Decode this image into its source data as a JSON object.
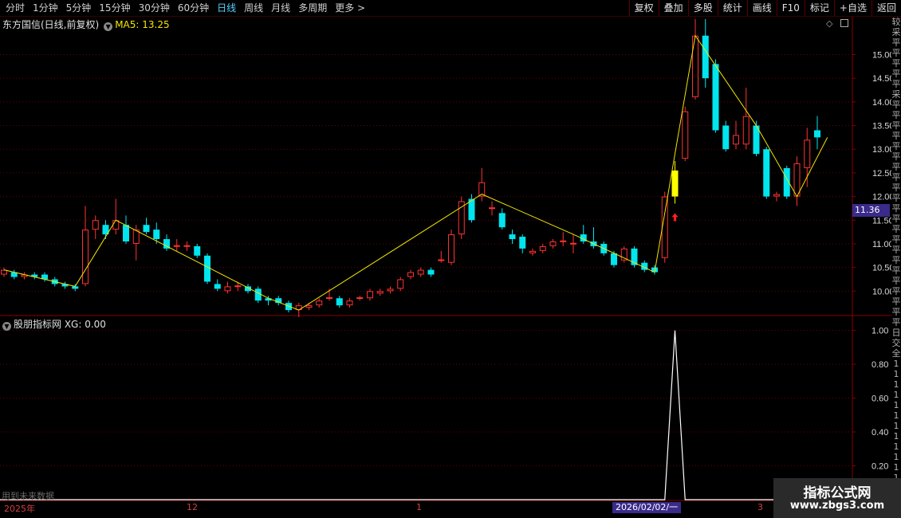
{
  "toolbar": {
    "left_items": [
      "分时",
      "1分钟",
      "5分钟",
      "15分钟",
      "30分钟",
      "60分钟",
      "日线",
      "周线",
      "月线",
      "多周期",
      "更多 >"
    ],
    "selected": "日线",
    "right_buttons": [
      "复权",
      "叠加",
      "多股",
      "统计",
      "画线",
      "F10",
      "标记",
      "+自选",
      "返回"
    ]
  },
  "main_panel": {
    "stock_name": "东方国信(日线,前复权)",
    "ma_label": "MA5: 13.25",
    "current_price_tag": "11.36",
    "price_axis_labels": [
      "15.00",
      "14.50",
      "14.00",
      "13.50",
      "13.00",
      "12.50",
      "12.00",
      "11.50",
      "11.00",
      "10.50",
      "10.00"
    ],
    "colors": {
      "up": "#ff3232",
      "down": "#00e5ee",
      "ma5": "#f2e600",
      "highlight": "#ffff00",
      "grid": "#6a0000",
      "background": "#000000"
    }
  },
  "sub_panel": {
    "title": "股朋指标网 XG: 0.00",
    "axis_labels": [
      "1.00",
      "0.80",
      "0.60",
      "0.40",
      "0.20"
    ],
    "future_note": "用到未来数据"
  },
  "x_axis": {
    "labels": [
      "2025年",
      "12",
      "1",
      "3"
    ],
    "cursor_date": "2026/02/02/一"
  },
  "right_strip_chars": [
    "较",
    "采",
    "平",
    "平",
    "平",
    "平",
    "平",
    "采",
    "平",
    "平",
    "平",
    "平",
    "平",
    "平",
    "平",
    "平",
    "平",
    "平",
    "平",
    "平",
    "平",
    "平",
    "平",
    "平",
    "平",
    "平",
    "平",
    "平",
    "平",
    "平",
    "日",
    "交",
    "全",
    "1",
    "1",
    "1",
    "1",
    "1",
    "1",
    "1",
    "1",
    "1",
    "1",
    "1",
    "1",
    "1",
    "1",
    "1",
    "1"
  ],
  "watermark": {
    "line1": "指标公式网",
    "line2": "www.zbgs3.com"
  },
  "chart_data": {
    "type": "candlestick",
    "y_range": [
      9.5,
      15.8
    ],
    "candles": [
      {
        "o": 10.35,
        "c": 10.45,
        "h": 10.5,
        "l": 10.3
      },
      {
        "o": 10.4,
        "c": 10.3,
        "h": 10.45,
        "l": 10.25
      },
      {
        "o": 10.3,
        "c": 10.35,
        "h": 10.4,
        "l": 10.25
      },
      {
        "o": 10.35,
        "c": 10.3,
        "h": 10.4,
        "l": 10.25
      },
      {
        "o": 10.35,
        "c": 10.25,
        "h": 10.4,
        "l": 10.2
      },
      {
        "o": 10.25,
        "c": 10.15,
        "h": 10.3,
        "l": 10.1
      },
      {
        "o": 10.15,
        "c": 10.1,
        "h": 10.2,
        "l": 10.05
      },
      {
        "o": 10.1,
        "c": 10.05,
        "h": 10.15,
        "l": 10.0
      },
      {
        "o": 10.15,
        "c": 11.3,
        "h": 11.8,
        "l": 10.1
      },
      {
        "o": 11.3,
        "c": 11.5,
        "h": 11.6,
        "l": 11.1
      },
      {
        "o": 11.4,
        "c": 11.2,
        "h": 11.5,
        "l": 11.1
      },
      {
        "o": 11.3,
        "c": 11.5,
        "h": 11.95,
        "l": 11.2
      },
      {
        "o": 11.4,
        "c": 11.05,
        "h": 11.6,
        "l": 11.0
      },
      {
        "o": 11.0,
        "c": 11.3,
        "h": 11.4,
        "l": 10.65
      },
      {
        "o": 11.4,
        "c": 11.25,
        "h": 11.55,
        "l": 11.2
      },
      {
        "o": 11.3,
        "c": 11.1,
        "h": 11.45,
        "l": 11.0
      },
      {
        "o": 11.1,
        "c": 10.9,
        "h": 11.2,
        "l": 10.85
      },
      {
        "o": 10.95,
        "c": 10.97,
        "h": 11.1,
        "l": 10.85
      },
      {
        "o": 10.95,
        "c": 10.97,
        "h": 11.05,
        "l": 10.85
      },
      {
        "o": 10.95,
        "c": 10.75,
        "h": 11.0,
        "l": 10.7
      },
      {
        "o": 10.75,
        "c": 10.2,
        "h": 10.8,
        "l": 10.15
      },
      {
        "o": 10.15,
        "c": 10.05,
        "h": 10.25,
        "l": 10.0
      },
      {
        "o": 10.0,
        "c": 10.1,
        "h": 10.2,
        "l": 9.95
      },
      {
        "o": 10.1,
        "c": 10.12,
        "h": 10.2,
        "l": 10.0
      },
      {
        "o": 10.1,
        "c": 10.0,
        "h": 10.15,
        "l": 9.95
      },
      {
        "o": 10.05,
        "c": 9.8,
        "h": 10.1,
        "l": 9.75
      },
      {
        "o": 9.85,
        "c": 9.8,
        "h": 9.9,
        "l": 9.7
      },
      {
        "o": 9.85,
        "c": 9.75,
        "h": 9.9,
        "l": 9.7
      },
      {
        "o": 9.75,
        "c": 9.6,
        "h": 9.8,
        "l": 9.55
      },
      {
        "o": 9.6,
        "c": 9.7,
        "h": 9.75,
        "l": 9.45
      },
      {
        "o": 9.65,
        "c": 9.7,
        "h": 9.75,
        "l": 9.6
      },
      {
        "o": 9.7,
        "c": 9.8,
        "h": 9.85,
        "l": 9.65
      },
      {
        "o": 9.85,
        "c": 9.87,
        "h": 10.05,
        "l": 9.8
      },
      {
        "o": 9.85,
        "c": 9.7,
        "h": 9.9,
        "l": 9.65
      },
      {
        "o": 9.7,
        "c": 9.8,
        "h": 9.85,
        "l": 9.65
      },
      {
        "o": 9.85,
        "c": 9.87,
        "h": 9.9,
        "l": 9.8
      },
      {
        "o": 9.85,
        "c": 10.0,
        "h": 10.05,
        "l": 9.8
      },
      {
        "o": 9.95,
        "c": 10.0,
        "h": 10.05,
        "l": 9.9
      },
      {
        "o": 10.0,
        "c": 10.05,
        "h": 10.1,
        "l": 9.95
      },
      {
        "o": 10.05,
        "c": 10.25,
        "h": 10.3,
        "l": 10.0
      },
      {
        "o": 10.3,
        "c": 10.4,
        "h": 10.45,
        "l": 10.25
      },
      {
        "o": 10.35,
        "c": 10.45,
        "h": 10.5,
        "l": 10.3
      },
      {
        "o": 10.45,
        "c": 10.35,
        "h": 10.5,
        "l": 10.3
      },
      {
        "o": 10.65,
        "c": 10.67,
        "h": 10.85,
        "l": 10.6
      },
      {
        "o": 10.6,
        "c": 11.2,
        "h": 11.3,
        "l": 10.55
      },
      {
        "o": 11.2,
        "c": 11.9,
        "h": 12.0,
        "l": 11.1
      },
      {
        "o": 11.95,
        "c": 11.5,
        "h": 12.05,
        "l": 11.45
      },
      {
        "o": 12.0,
        "c": 12.3,
        "h": 12.6,
        "l": 11.9
      },
      {
        "o": 11.75,
        "c": 11.77,
        "h": 11.9,
        "l": 11.6
      },
      {
        "o": 11.65,
        "c": 11.35,
        "h": 11.75,
        "l": 11.3
      },
      {
        "o": 11.2,
        "c": 11.1,
        "h": 11.3,
        "l": 11.0
      },
      {
        "o": 11.15,
        "c": 10.9,
        "h": 11.2,
        "l": 10.8
      },
      {
        "o": 10.8,
        "c": 10.85,
        "h": 10.9,
        "l": 10.75
      },
      {
        "o": 10.85,
        "c": 10.95,
        "h": 11.0,
        "l": 10.8
      },
      {
        "o": 10.95,
        "c": 11.05,
        "h": 11.1,
        "l": 10.9
      },
      {
        "o": 11.05,
        "c": 11.07,
        "h": 11.25,
        "l": 10.95
      },
      {
        "o": 11.0,
        "c": 11.02,
        "h": 11.2,
        "l": 10.8
      },
      {
        "o": 11.2,
        "c": 11.05,
        "h": 11.4,
        "l": 11.0
      },
      {
        "o": 11.05,
        "c": 10.95,
        "h": 11.35,
        "l": 10.9
      },
      {
        "o": 11.0,
        "c": 10.8,
        "h": 11.05,
        "l": 10.75
      },
      {
        "o": 10.8,
        "c": 10.55,
        "h": 10.85,
        "l": 10.5
      },
      {
        "o": 10.65,
        "c": 10.9,
        "h": 10.95,
        "l": 10.6
      },
      {
        "o": 10.9,
        "c": 10.55,
        "h": 10.95,
        "l": 10.5
      },
      {
        "o": 10.6,
        "c": 10.45,
        "h": 10.65,
        "l": 10.4
      },
      {
        "o": 10.5,
        "c": 10.4,
        "h": 10.55,
        "l": 10.35
      },
      {
        "o": 10.7,
        "c": 12.0,
        "h": 12.1,
        "l": 10.6
      },
      {
        "o": 12.0,
        "c": 12.55,
        "h": 12.75,
        "l": 11.85,
        "highlight": true
      },
      {
        "o": 12.8,
        "c": 13.8,
        "h": 13.9,
        "l": 12.75
      },
      {
        "o": 14.1,
        "c": 15.4,
        "h": 15.75,
        "l": 14.05
      },
      {
        "o": 15.4,
        "c": 14.5,
        "h": 15.75,
        "l": 14.3
      },
      {
        "o": 14.8,
        "c": 13.4,
        "h": 14.9,
        "l": 13.35
      },
      {
        "o": 13.5,
        "c": 13.0,
        "h": 13.6,
        "l": 12.95
      },
      {
        "o": 13.1,
        "c": 13.3,
        "h": 13.6,
        "l": 13.0
      },
      {
        "o": 13.1,
        "c": 13.7,
        "h": 14.3,
        "l": 13.0
      },
      {
        "o": 13.5,
        "c": 12.9,
        "h": 13.6,
        "l": 12.85
      },
      {
        "o": 13.0,
        "c": 12.0,
        "h": 13.05,
        "l": 11.95
      },
      {
        "o": 12.0,
        "c": 12.05,
        "h": 12.1,
        "l": 11.9
      },
      {
        "o": 12.6,
        "c": 12.0,
        "h": 12.65,
        "l": 11.95
      },
      {
        "o": 12.0,
        "c": 12.7,
        "h": 12.85,
        "l": 11.8
      },
      {
        "o": 12.6,
        "c": 13.2,
        "h": 13.45,
        "l": 12.2
      },
      {
        "o": 13.4,
        "c": 13.25,
        "h": 13.7,
        "l": 13.0
      }
    ],
    "ma5_points": [
      {
        "i": 0,
        "v": 10.45
      },
      {
        "i": 7,
        "v": 10.1
      },
      {
        "i": 11,
        "v": 11.5
      },
      {
        "i": 26,
        "v": 9.85
      },
      {
        "i": 29,
        "v": 9.6
      },
      {
        "i": 47,
        "v": 12.05
      },
      {
        "i": 56,
        "v": 11.2
      },
      {
        "i": 64,
        "v": 10.4
      },
      {
        "i": 68,
        "v": 15.4
      },
      {
        "i": 74,
        "v": 13.5
      },
      {
        "i": 78,
        "v": 12.0
      },
      {
        "i": 81,
        "v": 13.25
      }
    ],
    "xg_signal": {
      "index": 66,
      "value": 1.0
    },
    "xg_y_range": [
      0,
      1.05
    ]
  }
}
